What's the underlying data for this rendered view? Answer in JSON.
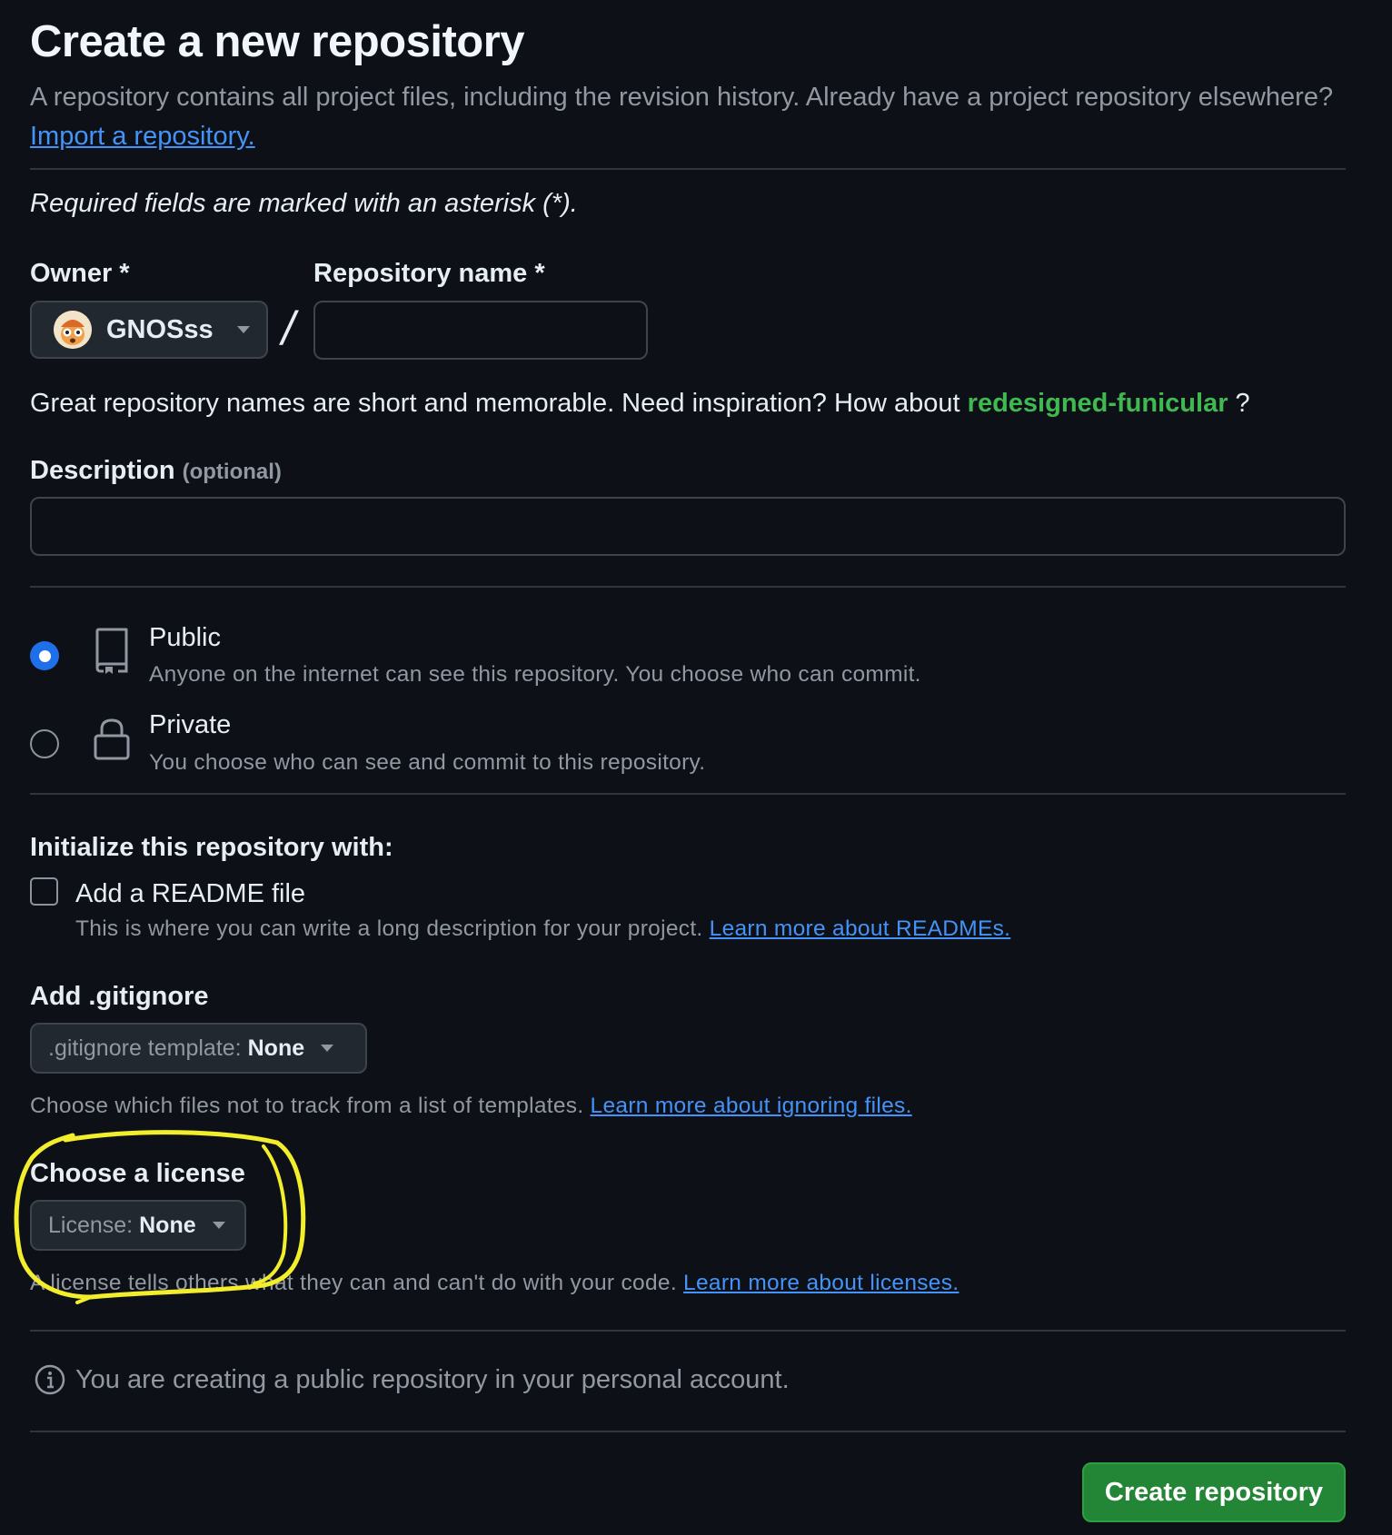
{
  "header": {
    "title": "Create a new repository",
    "intro_text": "A repository contains all project files, including the revision history. Already have a project repository elsewhere?",
    "import_link": "Import a repository."
  },
  "required_note": "Required fields are marked with an asterisk (*).",
  "owner": {
    "label": "Owner *",
    "selected": "GNOSss"
  },
  "separator": "/",
  "repo_name": {
    "label": "Repository name *",
    "value": "",
    "placeholder": ""
  },
  "name_hint": {
    "prefix": "Great repository names are short and memorable. Need inspiration? How about",
    "suggestion": "redesigned-funicular",
    "suffix": "?"
  },
  "description": {
    "label": "Description",
    "optional": "(optional)",
    "value": "",
    "placeholder": ""
  },
  "visibility": {
    "options": [
      {
        "title": "Public",
        "description": "Anyone on the internet can see this repository. You choose who can commit.",
        "icon": "repo-icon",
        "selected": true
      },
      {
        "title": "Private",
        "description": "You choose who can see and commit to this repository.",
        "icon": "lock-icon",
        "selected": false
      }
    ]
  },
  "initialize": {
    "heading": "Initialize this repository with:",
    "readme": {
      "label": "Add a README file",
      "checked": false,
      "help": "This is where you can write a long description for your project.",
      "link": "Learn more about READMEs."
    }
  },
  "gitignore": {
    "heading": "Add .gitignore",
    "prefix": ".gitignore template:",
    "value": "None",
    "help": "Choose which files not to track from a list of templates.",
    "link": "Learn more about ignoring files."
  },
  "license": {
    "heading": "Choose a license",
    "prefix": "License:",
    "value": "None",
    "help": "A license tells others what they can and can't do with your code.",
    "link": "Learn more about licenses."
  },
  "info_notice": "You are creating a public repository in your personal account.",
  "submit": {
    "label": "Create repository"
  },
  "colors": {
    "background": "#0d1117",
    "link": "#4493f8",
    "suggestion": "#3fb950",
    "primary_button": "#238636",
    "radio_selected": "#1f6feb",
    "highlight_annotation": "#f2ee2c"
  }
}
